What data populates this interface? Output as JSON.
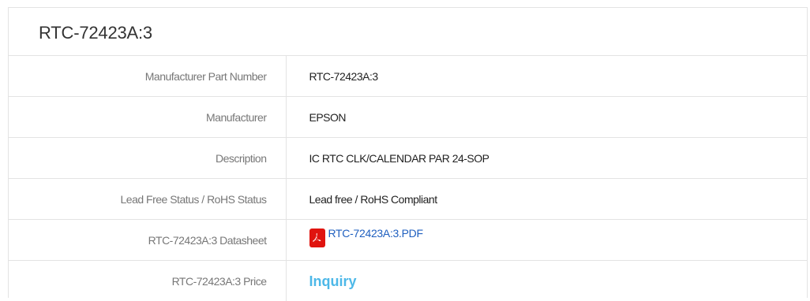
{
  "panel": {
    "title": "RTC-72423A:3"
  },
  "rows": [
    {
      "label": "Manufacturer Part Number",
      "value": "RTC-72423A:3"
    },
    {
      "label": "Manufacturer",
      "value": "EPSON"
    },
    {
      "label": "Description",
      "value": "IC RTC CLK/CALENDAR PAR 24-SOP"
    },
    {
      "label": "Lead Free Status / RoHS Status",
      "value": "Lead free / RoHS Compliant"
    },
    {
      "label": "RTC-72423A:3 Datasheet",
      "value": "RTC-72423A:3.PDF",
      "icon": "pdf-icon"
    },
    {
      "label": "RTC-72423A:3 Price",
      "value": "Inquiry"
    }
  ],
  "colors": {
    "link": "#1f5fbf",
    "inquiry": "#4db8e8",
    "pdf_icon": "#e0140f",
    "border": "#e3e3e3"
  }
}
